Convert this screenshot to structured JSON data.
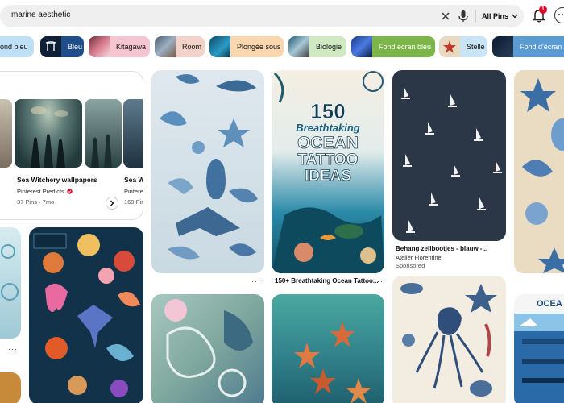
{
  "search": {
    "query": "marine aesthetic",
    "scope_label": "All Pins",
    "notification_count": "1"
  },
  "chips": [
    {
      "label": "ond bleu",
      "bg": "#bfe0f7"
    },
    {
      "label": "Bleu",
      "bg": "#1f4e8a",
      "fg": "#fff"
    },
    {
      "label": "Kitagawa",
      "bg": "#f5c6d2"
    },
    {
      "label": "Room",
      "bg": "#f2d2c9"
    },
    {
      "label": "Plongée sous",
      "bg": "#fbd7b0"
    },
    {
      "label": "Biologie",
      "bg": "#cfe9c3"
    },
    {
      "label": "Fond ecran bleu",
      "bg": "#7cb54a",
      "fg": "#fff"
    },
    {
      "label": "Stelle",
      "bg": "#c9e5f5"
    },
    {
      "label": "Fond d'écran l",
      "bg": "#5a9bd4",
      "fg": "#fff"
    }
  ],
  "board": {
    "title": "Sea Witchery wallpapers",
    "author": "Pinterest Predicts",
    "meta": "37 Pins · 7mo",
    "title2": "Sea W",
    "author2": "Pinterest",
    "meta2": "169 Pin"
  },
  "pins": {
    "tattoo_title": "150+ Breathtaking Ocean Tattoo...",
    "tattoo_art_line1": "150",
    "tattoo_art_line2": "Breathtaking",
    "tattoo_art_line3": "OCEAN",
    "tattoo_art_line4": "TATTOO",
    "tattoo_art_line5": "IDEAS",
    "boats_title": "Behang zeilbootjes - blauw -...",
    "boats_author": "Atelier Florentine",
    "boats_sponsored": "Sponsored",
    "poster_title": "OCEA",
    "more_dots": "···"
  },
  "colors": {
    "accent": "#e60023",
    "chip_text": "#111111"
  }
}
